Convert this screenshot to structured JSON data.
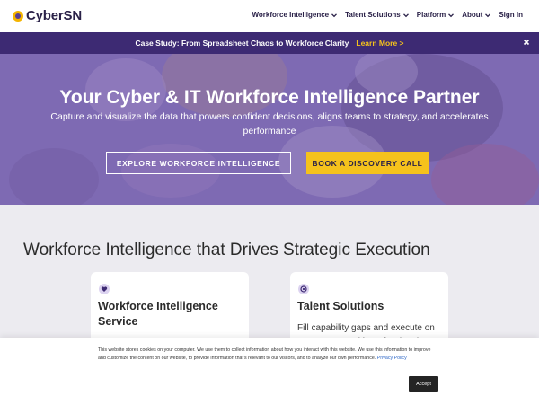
{
  "header": {
    "logo_text": "CyberSN",
    "nav": [
      {
        "label": "Workforce Intelligence",
        "has_dropdown": true
      },
      {
        "label": "Talent Solutions",
        "has_dropdown": true
      },
      {
        "label": "Platform",
        "has_dropdown": true
      },
      {
        "label": "About",
        "has_dropdown": true
      },
      {
        "label": "Sign In",
        "has_dropdown": false
      }
    ]
  },
  "announcement": {
    "text": "Case Study: From Spreadsheet Chaos to Workforce Clarity",
    "link_label": "Learn More >",
    "close_icon": "close-icon"
  },
  "hero": {
    "title": "Your Cyber & IT Workforce Intelligence Partner",
    "subtitle": "Capture and visualize the data that powers confident decisions, aligns teams to strategy, and accelerates performance",
    "primary_button": "EXPLORE WORKFORCE INTELLIGENCE",
    "secondary_button": "BOOK A DISCOVERY CALL"
  },
  "section": {
    "title": "Workforce Intelligence that Drives Strategic Execution",
    "cards": [
      {
        "icon": "heart-icon",
        "title": "Workforce Intelligence Service",
        "body": ""
      },
      {
        "icon": "target-icon",
        "title": "Talent Solutions",
        "body": "Fill capability gaps and execute on your strategy with professionals"
      }
    ]
  },
  "cookie_banner": {
    "text": "This website stores cookies on your computer. We use them to collect information about how you interact with this website. We use this information to improve and customize the content on our website, to provide information that's relevant to our visitors, and to analyze our own performance.",
    "policy_link": "Privacy Policy",
    "accept_label": "Accept"
  },
  "colors": {
    "brand_purple": "#3d2a73",
    "accent_yellow": "#f5c21c",
    "hero_tint": "#7660ac",
    "page_bg": "#ecebf0"
  }
}
